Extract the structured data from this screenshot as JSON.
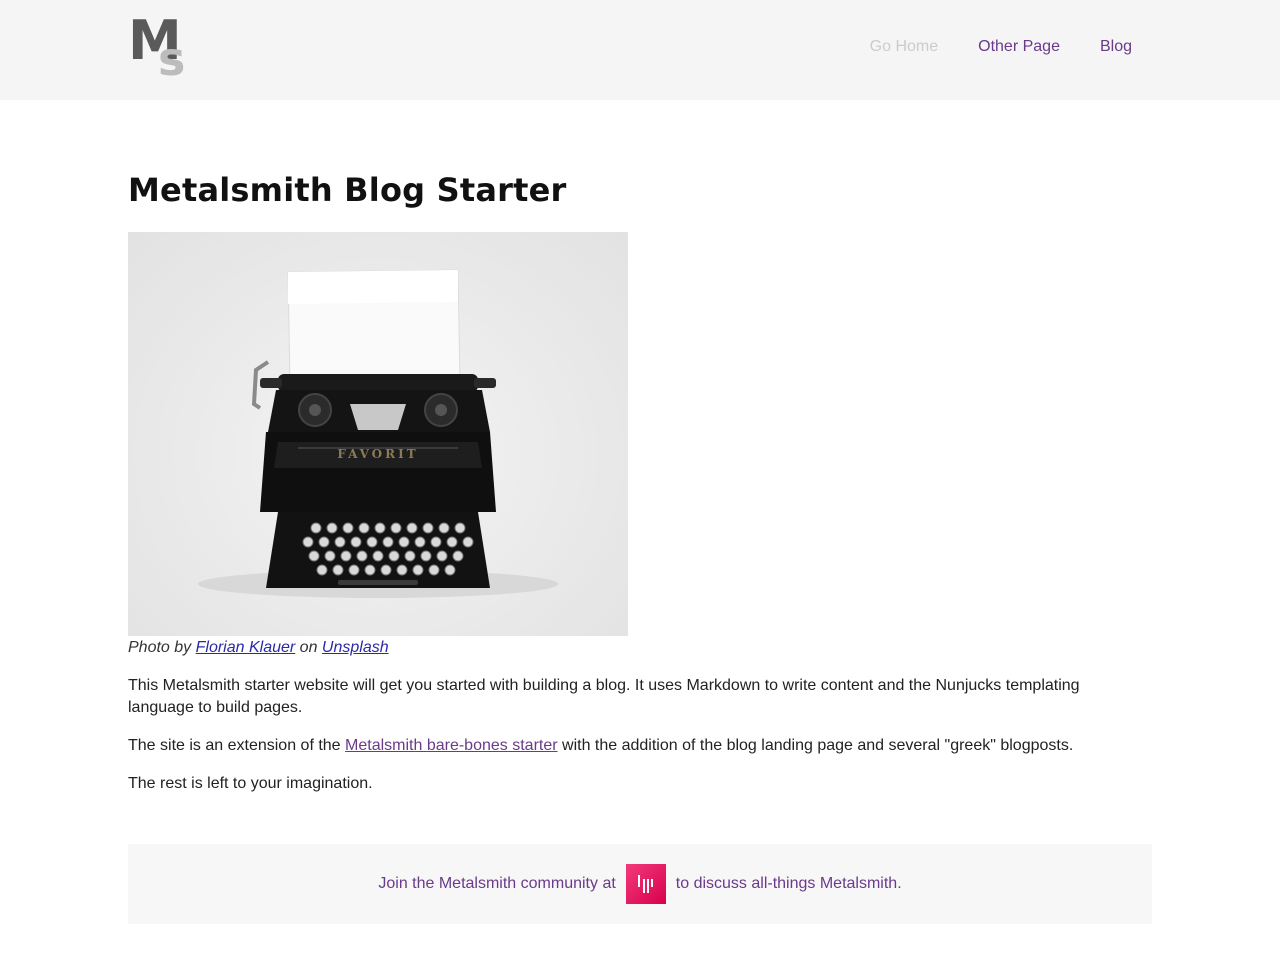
{
  "header": {
    "logo": {
      "letter_m": "M",
      "letter_s": "s"
    },
    "nav": [
      {
        "label": "Go Home",
        "active": true
      },
      {
        "label": "Other Page",
        "active": false
      },
      {
        "label": "Blog",
        "active": false
      }
    ]
  },
  "main": {
    "title": "Metalsmith Blog Starter",
    "caption": {
      "prefix": "Photo by",
      "author_link": "Florian Klauer",
      "middle": "on",
      "source_link": "Unsplash"
    },
    "paragraphs": {
      "p1": "This Metalsmith starter website will get you started with building a blog. It uses Markdown to write content and the Nunjucks templating language to build pages.",
      "p2_before": "The site is an extension of the",
      "p2_link": "Metalsmith bare-bones starter",
      "p2_after": "with the addition of the blog landing page and several \"greek\" blogposts.",
      "p3": "The rest is left to your imagination."
    }
  },
  "footer": {
    "before": "Join the Metalsmith community at",
    "icon": "gitter-icon",
    "after": "to discuss all-things Metalsmith."
  },
  "colors": {
    "accent": "#6b3a8a",
    "header_bg": "#f5f5f5",
    "link_blue": "#2a2aa8",
    "gitter": "#ed1965"
  }
}
